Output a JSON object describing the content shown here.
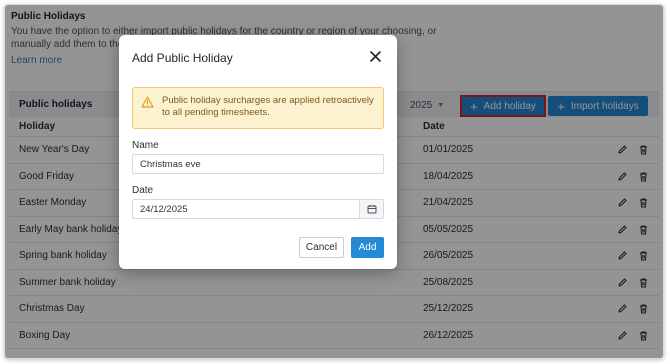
{
  "section": {
    "title": "Public Holidays",
    "description": "You have the option to either import public holidays for the country or region of your choosing, or manually add them to the",
    "learn_more": "Learn more"
  },
  "table": {
    "title": "Public holidays",
    "year": "2025",
    "add_holiday_label": "Add holiday",
    "import_label": "Import holidays",
    "col_holiday": "Holiday",
    "col_date": "Date",
    "rows": [
      {
        "name": "New Year's Day",
        "date": "01/01/2025"
      },
      {
        "name": "Good Friday",
        "date": "18/04/2025"
      },
      {
        "name": "Easter Monday",
        "date": "21/04/2025"
      },
      {
        "name": "Early May bank holiday",
        "date": "05/05/2025"
      },
      {
        "name": "Spring bank holiday",
        "date": "26/05/2025"
      },
      {
        "name": "Summer bank holiday",
        "date": "25/08/2025"
      },
      {
        "name": "Christmas Day",
        "date": "25/12/2025"
      },
      {
        "name": "Boxing Day",
        "date": "26/12/2025"
      }
    ]
  },
  "modal": {
    "title": "Add Public Holiday",
    "alert": "Public holiday surcharges are applied retroactively to all pending timesheets.",
    "name_label": "Name",
    "name_value": "Christmas eve",
    "date_label": "Date",
    "date_value": "24/12/2025",
    "cancel_label": "Cancel",
    "add_label": "Add"
  },
  "colors": {
    "accent": "#2489d6",
    "highlight": "#d9232e",
    "alert_bg": "#fdf2cf"
  }
}
